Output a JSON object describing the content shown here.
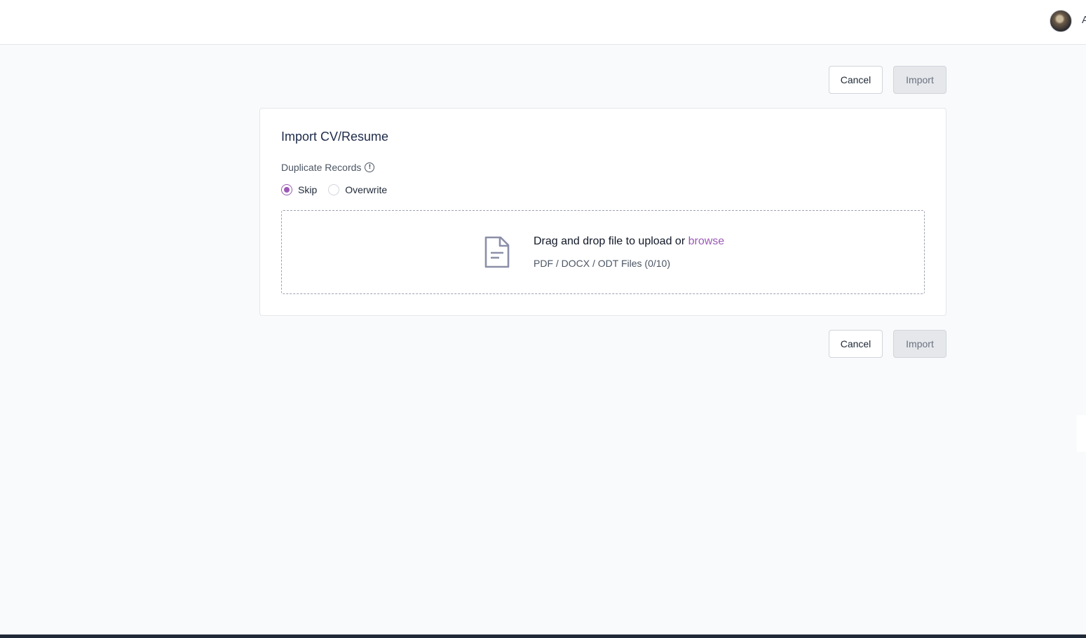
{
  "header": {
    "user_initial": "A"
  },
  "actions": {
    "cancel_label": "Cancel",
    "import_label": "Import"
  },
  "card": {
    "title": "Import CV/Resume",
    "duplicate_label": "Duplicate Records",
    "info_icon": "info-circle-icon",
    "radio_options": [
      {
        "label": "Skip",
        "checked": true
      },
      {
        "label": "Overwrite",
        "checked": false
      }
    ],
    "dropzone": {
      "main_text": "Drag and drop file to upload or",
      "browse_text": "browse",
      "sub_text": "PDF / DOCX / ODT Files (0/10)",
      "icon": "document-icon"
    }
  },
  "colors": {
    "accent": "#9b59b6",
    "background": "#f9fafb",
    "title": "#1e2b4a"
  }
}
